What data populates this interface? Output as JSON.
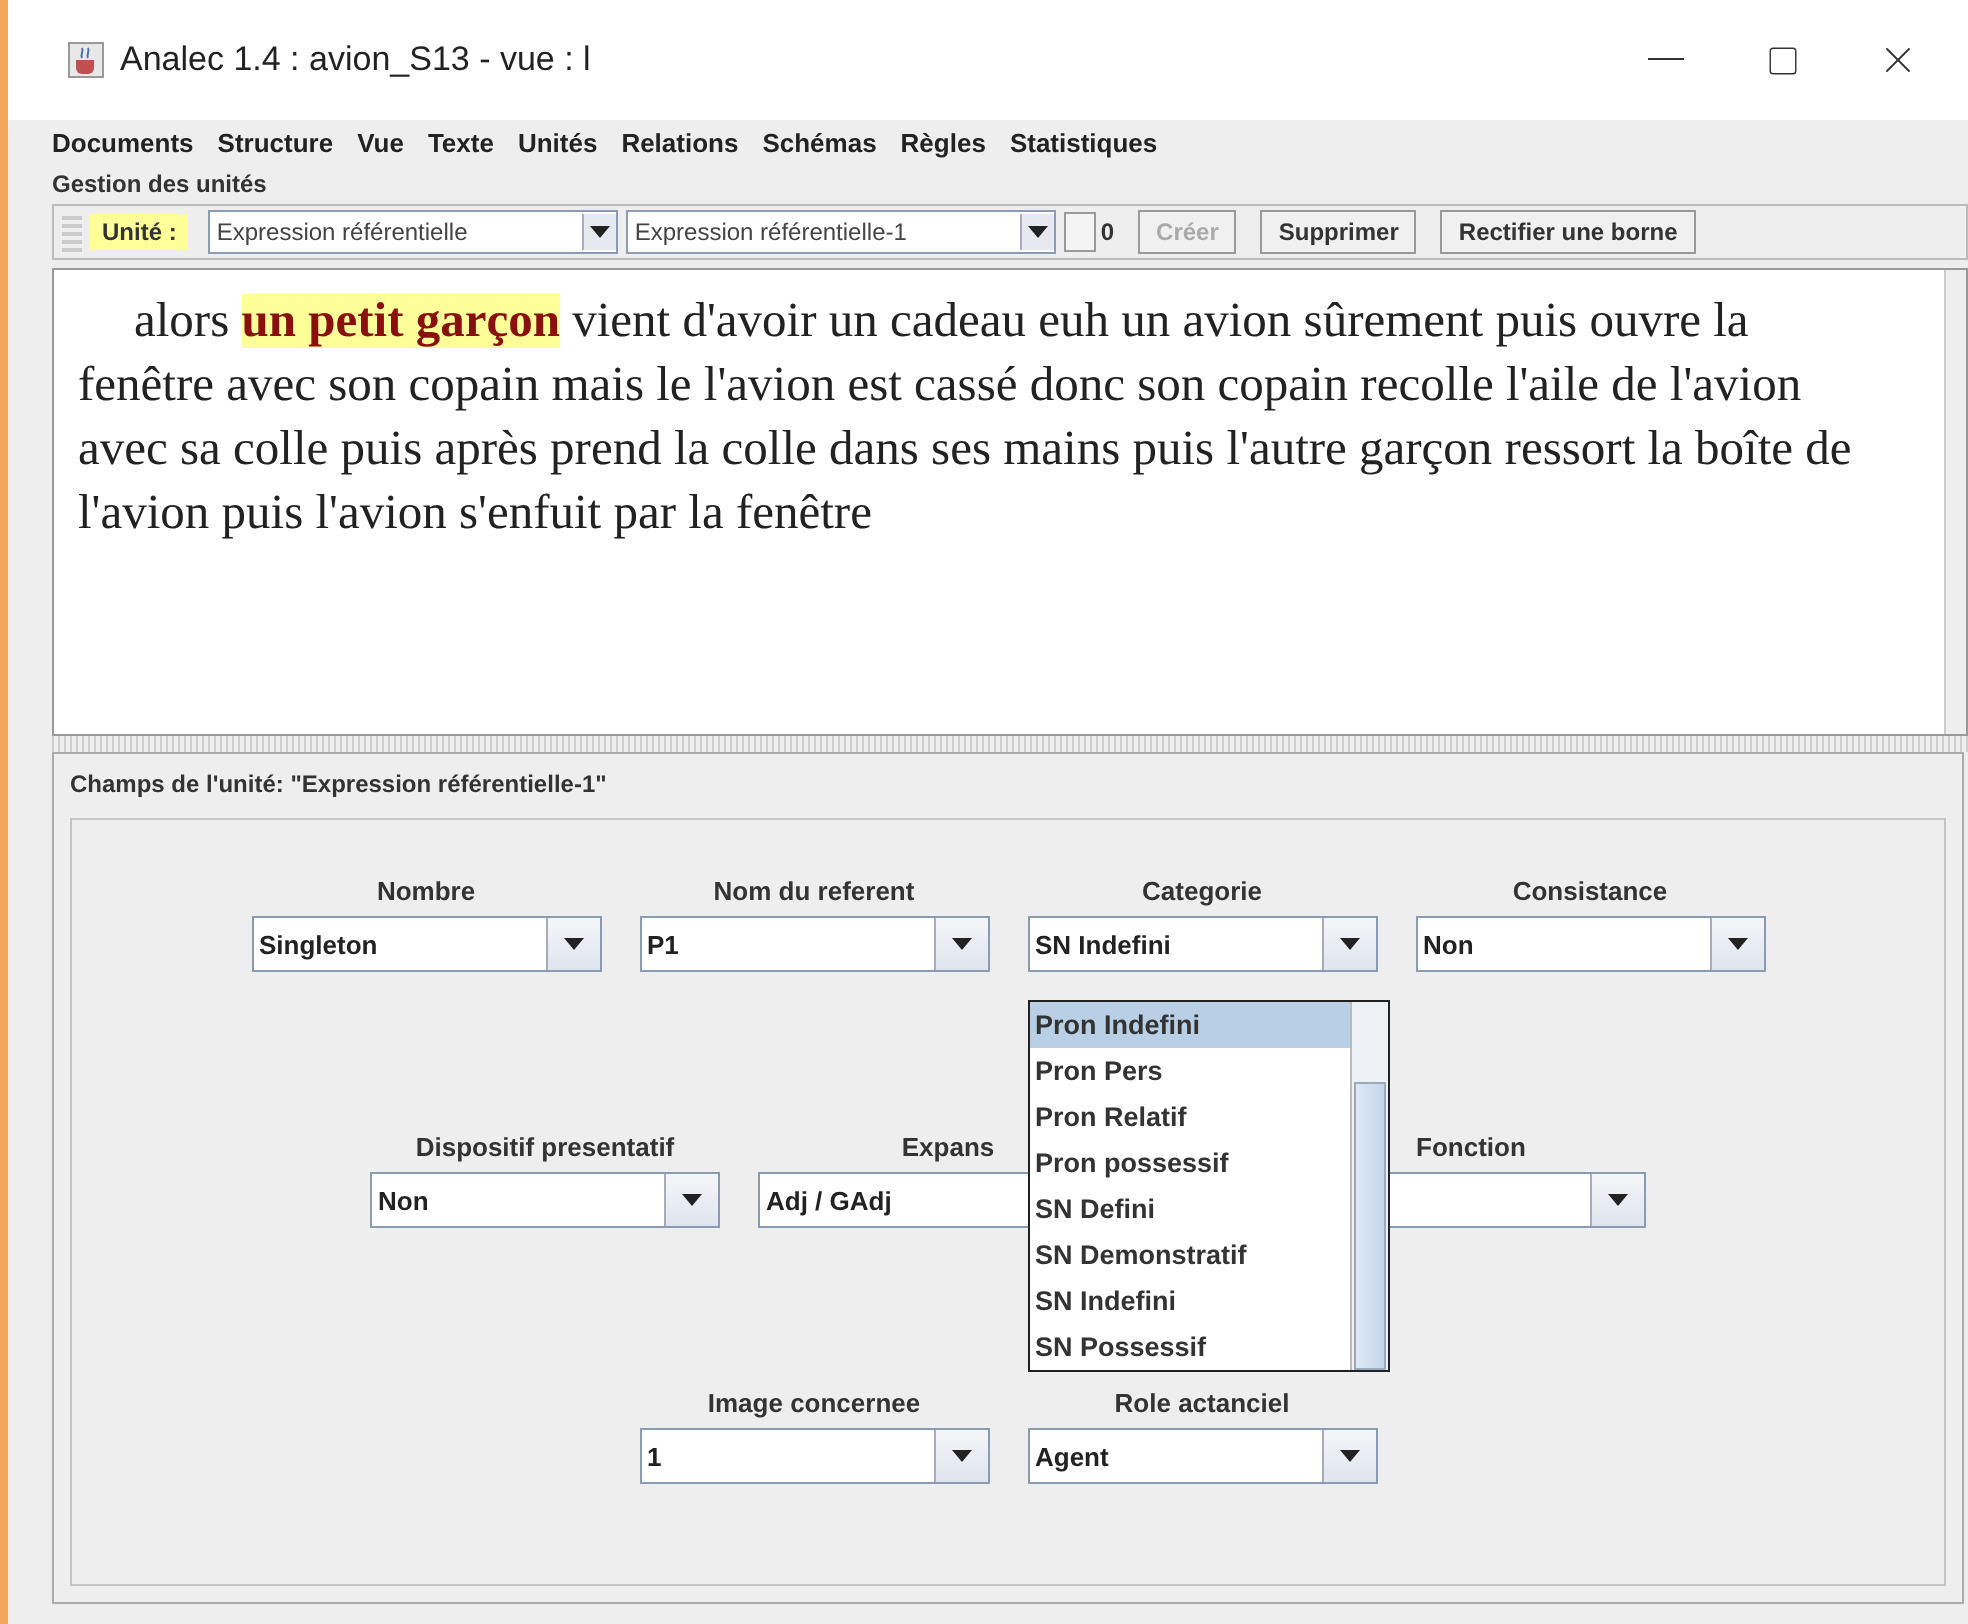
{
  "window": {
    "title": "Analec 1.4 : avion_S13 - vue : l"
  },
  "menu": [
    "Documents",
    "Structure",
    "Vue",
    "Texte",
    "Unités",
    "Relations",
    "Schémas",
    "Règles",
    "Statistiques"
  ],
  "units_panel": {
    "title": "Gestion des unités",
    "unit_label": "Unité :",
    "type_combo": "Expression référentielle",
    "instance_combo": "Expression référentielle-1",
    "spinner": "0",
    "buttons": [
      {
        "label": "Créer",
        "disabled": true
      },
      {
        "label": "Supprimer",
        "disabled": false
      },
      {
        "label": "Rectifier une borne",
        "disabled": false
      }
    ]
  },
  "text": [
    {
      "text": "alors ",
      "highlighted": false
    },
    {
      "text": "un petit garçon",
      "highlighted": true
    },
    {
      "text": " vient d'avoir un cadeau euh un avion sûrement puis ouvre la fenêtre avec son copain mais le l'avion est cassé donc son copain recolle l'aile de l'avion avec sa colle puis après prend la colle dans ses mains puis l'autre garçon ressort la boîte de l'avion puis l'avion s'enfuit par la fenêtre",
      "highlighted": false
    }
  ],
  "fields_panel": {
    "title": "Champs de l'unité:  \"Expression référentielle-1\"",
    "fields": [
      {
        "label": "Nombre",
        "value": "Singleton"
      },
      {
        "label": "Nom du referent",
        "value": "P1"
      },
      {
        "label": "Categorie",
        "value": "SN Indefini",
        "open": true
      },
      {
        "label": "Consistance",
        "value": "Non"
      },
      {
        "label": "Dispositif presentatif",
        "value": "Non"
      },
      {
        "label": "Expans",
        "value": "Adj / GAdj"
      },
      {
        "label": "Fonction"
      },
      {
        "label": "Image concernee",
        "value": "1"
      },
      {
        "label": "Role actanciel",
        "value": "Agent"
      }
    ]
  },
  "dropdown": [
    {
      "label": "Pron Indefini",
      "selected": true
    },
    {
      "label": "Pron Pers",
      "selected": false
    },
    {
      "label": "Pron Relatif",
      "selected": false
    },
    {
      "label": "Pron possessif",
      "selected": false
    },
    {
      "label": "SN Defini",
      "selected": false
    },
    {
      "label": "SN Demonstratif",
      "selected": false
    },
    {
      "label": "SN Indefini",
      "selected": false
    },
    {
      "label": "SN Possessif",
      "selected": false
    }
  ]
}
